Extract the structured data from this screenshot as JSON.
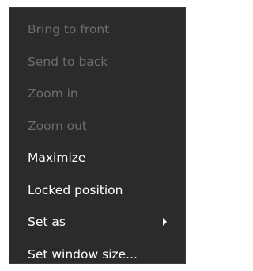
{
  "context_menu": {
    "items": [
      {
        "label": "Bring to front",
        "enabled": false
      },
      {
        "label": "Send to back",
        "enabled": false
      },
      {
        "label": "Zoom in",
        "enabled": false
      },
      {
        "label": "Zoom out",
        "enabled": false
      },
      {
        "label": "Maximize",
        "enabled": true
      },
      {
        "label": "Locked position",
        "enabled": true
      },
      {
        "label": "Set as",
        "enabled": true,
        "submenu_icon": "chevron-right-icon"
      },
      {
        "label": "Set window size...",
        "enabled": true
      }
    ]
  },
  "colors": {
    "menu_background": "#2b2b2b",
    "menu_border": "#3c3c3c",
    "text_enabled": "#ffffff",
    "text_disabled": "#6d6d6d"
  }
}
